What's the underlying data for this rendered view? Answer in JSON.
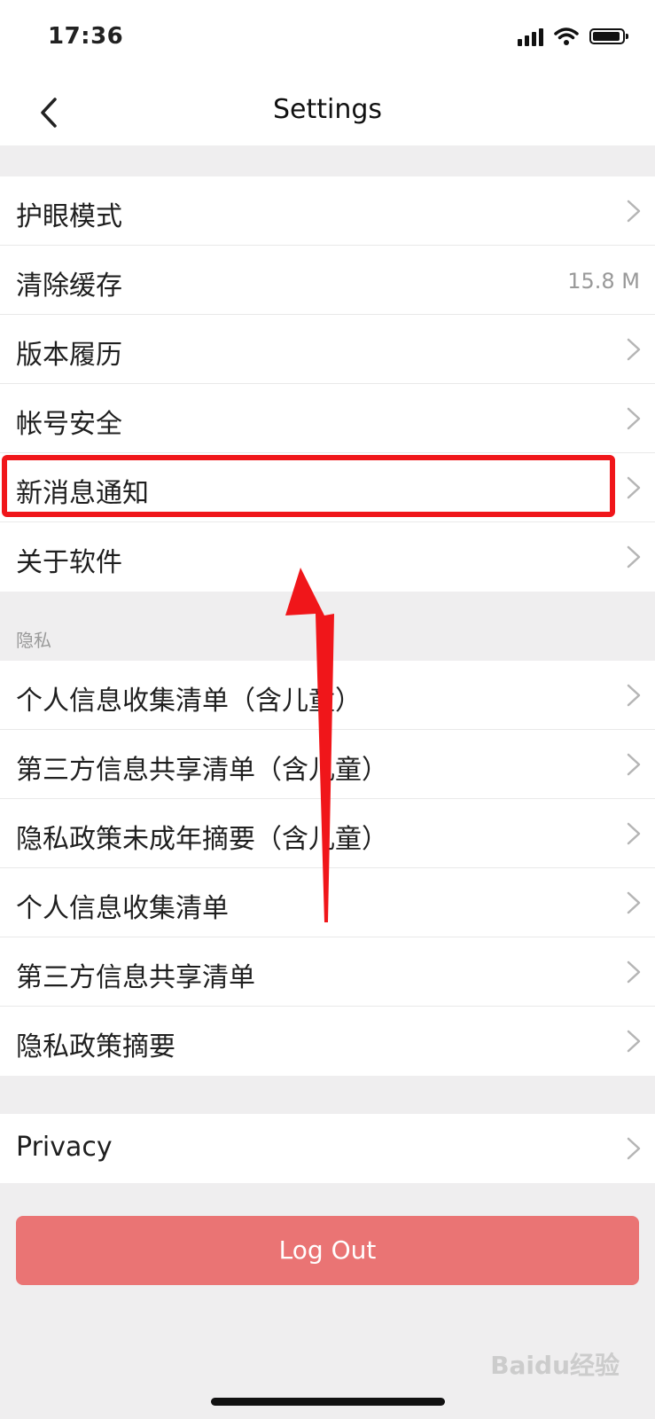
{
  "status_bar": {
    "time": "17:36"
  },
  "nav": {
    "title": "Settings"
  },
  "group1": [
    {
      "label": "护眼模式",
      "value": ""
    },
    {
      "label": "清除缓存",
      "value": "15.8 M"
    },
    {
      "label": "版本履历",
      "value": ""
    },
    {
      "label": "帐号安全",
      "value": ""
    },
    {
      "label": "新消息通知",
      "value": ""
    },
    {
      "label": "关于软件",
      "value": ""
    }
  ],
  "privacy_section": {
    "header": "隐私",
    "items": [
      {
        "label": "个人信息收集清单（含儿童）"
      },
      {
        "label": "第三方信息共享清单（含儿童）"
      },
      {
        "label": "隐私政策未成年摘要（含儿童）"
      },
      {
        "label": "个人信息收集清单"
      },
      {
        "label": "第三方信息共享清单"
      },
      {
        "label": "隐私政策摘要"
      }
    ]
  },
  "group3": [
    {
      "label": "Privacy"
    }
  ],
  "logout": {
    "label": "Log Out"
  },
  "watermark": {
    "text": "Baidu经验"
  },
  "colors": {
    "accent_red": "#f0161a",
    "logout_bg": "#ea7474"
  }
}
